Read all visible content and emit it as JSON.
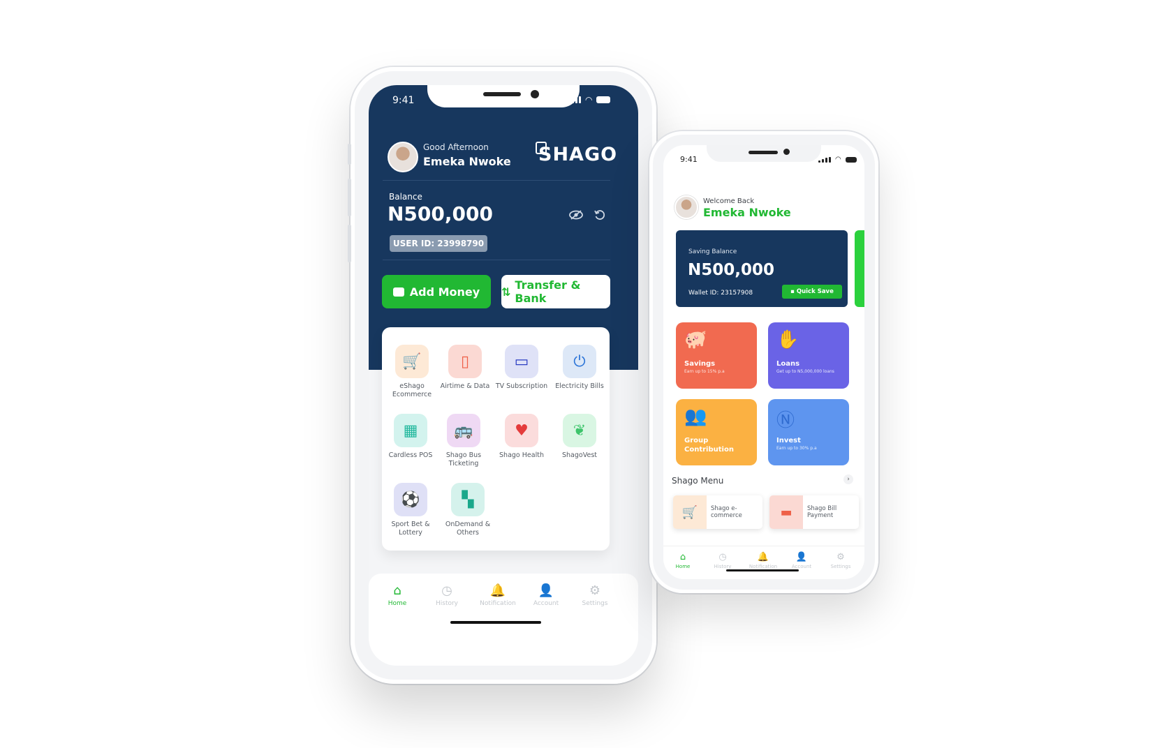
{
  "phone_main": {
    "status_time": "9:41",
    "greeting": "Good Afternoon",
    "user_name": "Emeka Nwoke",
    "logo_text": "SHAGO",
    "balance_label": "Balance",
    "balance_value": "N500,000",
    "user_id": "USER ID: 23998790",
    "actions": {
      "add_money": "Add Money",
      "transfer_bank": "Transfer & Bank"
    },
    "services": [
      {
        "label": "eShago Ecommerce",
        "icon": "cart-icon",
        "bg": "#fde9d6",
        "fg": "#f39a2d"
      },
      {
        "label": "Airtime & Data",
        "icon": "phone-icon",
        "bg": "#fbd9d3",
        "fg": "#ee6048"
      },
      {
        "label": "TV Subscription",
        "icon": "tv-icon",
        "bg": "#dfe2f7",
        "fg": "#2a3cc2"
      },
      {
        "label": "Electricity Bills",
        "icon": "plug-icon",
        "bg": "#dde8f7",
        "fg": "#2b74d8"
      },
      {
        "label": "Cardless POS",
        "icon": "pos-icon",
        "bg": "#d3f3ee",
        "fg": "#1fb79c"
      },
      {
        "label": "Shago Bus Ticketing",
        "icon": "bus-icon",
        "bg": "#efd9f4",
        "fg": "#a247c3"
      },
      {
        "label": "Shago Health",
        "icon": "heart-icon",
        "bg": "#fbdcdc",
        "fg": "#e43b3b"
      },
      {
        "label": "ShagoVest",
        "icon": "plant-icon",
        "bg": "#d9f6e3",
        "fg": "#3dc46b"
      },
      {
        "label": "Sport Bet & Lottery",
        "icon": "ball-icon",
        "bg": "#dfe0f6",
        "fg": "#3a3dab"
      },
      {
        "label": "OnDemand & Others",
        "icon": "grid-icon",
        "bg": "#d5f2ec",
        "fg": "#1aa88b"
      }
    ],
    "nav": [
      {
        "label": "Home",
        "icon": "home-icon",
        "active": true
      },
      {
        "label": "History",
        "icon": "clock-icon",
        "active": false
      },
      {
        "label": "Notification",
        "icon": "bell-icon",
        "active": false
      },
      {
        "label": "Account",
        "icon": "user-icon",
        "active": false
      },
      {
        "label": "Settings",
        "icon": "gear-icon",
        "active": false
      }
    ]
  },
  "phone_secondary": {
    "status_time": "9:41",
    "welcome": "Welcome Back",
    "user_name": "Emeka Nwoke",
    "saving_label": "Saving Balance",
    "saving_value": "N500,000",
    "wallet_id": "Wallet ID: 23157908",
    "quick_save": "Quick Save",
    "tiles": [
      {
        "title": "Savings",
        "subtitle": "Earn up to 15% p.a",
        "color": "#f16a50",
        "icon": "piggy-bank-icon"
      },
      {
        "title": "Loans",
        "subtitle": "Get up to N5,000,000 loans",
        "color": "#6a63e6",
        "icon": "hand-coin-icon"
      },
      {
        "title": "Group Contribution",
        "subtitle": "",
        "color": "#fbb142",
        "icon": "group-icon"
      },
      {
        "title": "Invest",
        "subtitle": "Earn up to 30% p.a",
        "color": "#5e95ef",
        "icon": "invest-icon"
      }
    ],
    "menu_title": "Shago Menu",
    "menu_items": [
      {
        "label": "Shago e-commerce",
        "icon": "cart-icon",
        "bg": "#fde9d6",
        "fg": "#f39a2d"
      },
      {
        "label": "Shago Bill Payment",
        "icon": "card-icon",
        "bg": "#fbd9d3",
        "fg": "#ee6048"
      }
    ],
    "nav": [
      {
        "label": "Home",
        "icon": "home-icon",
        "active": true
      },
      {
        "label": "History",
        "icon": "clock-icon",
        "active": false
      },
      {
        "label": "Notification",
        "icon": "bell-icon",
        "active": false
      },
      {
        "label": "Account",
        "icon": "user-icon",
        "active": false
      },
      {
        "label": "Settings",
        "icon": "gear-icon",
        "active": false
      }
    ]
  },
  "colors": {
    "navy": "#17375e",
    "green": "#21b833",
    "nav_inactive": "#c3c7cc"
  }
}
